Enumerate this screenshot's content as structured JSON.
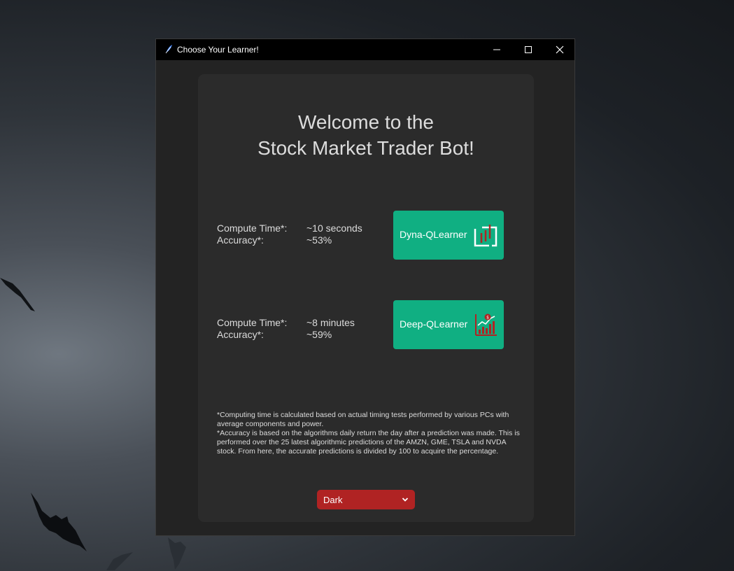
{
  "window": {
    "title": "Choose Your Learner!",
    "controls": [
      "minimize-icon",
      "maximize-icon",
      "close-icon"
    ]
  },
  "main": {
    "heading_line1": "Welcome to the",
    "heading_line2": "Stock Market Trader Bot!",
    "learners": [
      {
        "compute_label": "Compute Time*:",
        "compute_value": "~10 seconds",
        "accuracy_label": "Accuracy*:",
        "accuracy_value": "~53%",
        "button_label": "Dyna-QLearner",
        "icon": "candlestick-chart-icon"
      },
      {
        "compute_label": "Compute Time*:",
        "compute_value": "~8 minutes",
        "accuracy_label": "Accuracy*:",
        "accuracy_value": "~59%",
        "button_label": "Deep-QLearner",
        "icon": "growth-bar-chart-icon"
      }
    ],
    "footnote_line1": "*Computing time is calculated based on actual timing tests performed by various PCs with average components and power.",
    "footnote_line2": "*Accuracy is based on the algorithms daily return the day after a prediction was made. This is performed over the 25 latest algorithmic predictions of the AMZN, GME, TSLA and NVDA stock. From here, the accurate predictions is divided by 100 to acquire the percentage.",
    "theme_select_value": "Dark"
  },
  "colors": {
    "accent_button": "#10af82",
    "theme_select": "#b02323",
    "panel": "#2b2b2b",
    "window_bg": "#232323",
    "icon_red": "#b02323"
  }
}
